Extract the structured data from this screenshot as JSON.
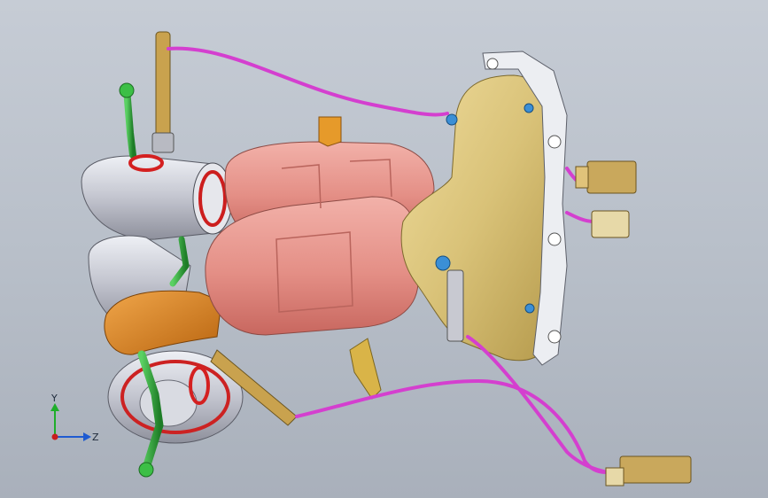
{
  "triad": {
    "y_label": "Y",
    "z_label": "Z"
  },
  "colors": {
    "background_top": "#c6ccd5",
    "catalyst": "#e7978f",
    "manifold": "#d9c278",
    "turbo": "#c8c9d2",
    "downpipe": "#d98722",
    "bracket_green": "#2fa43a",
    "wire": "#d43fcf",
    "connector": "#c9a85c",
    "gasket_red": "#d42020",
    "sensor_blue": "#3b8fd6"
  }
}
